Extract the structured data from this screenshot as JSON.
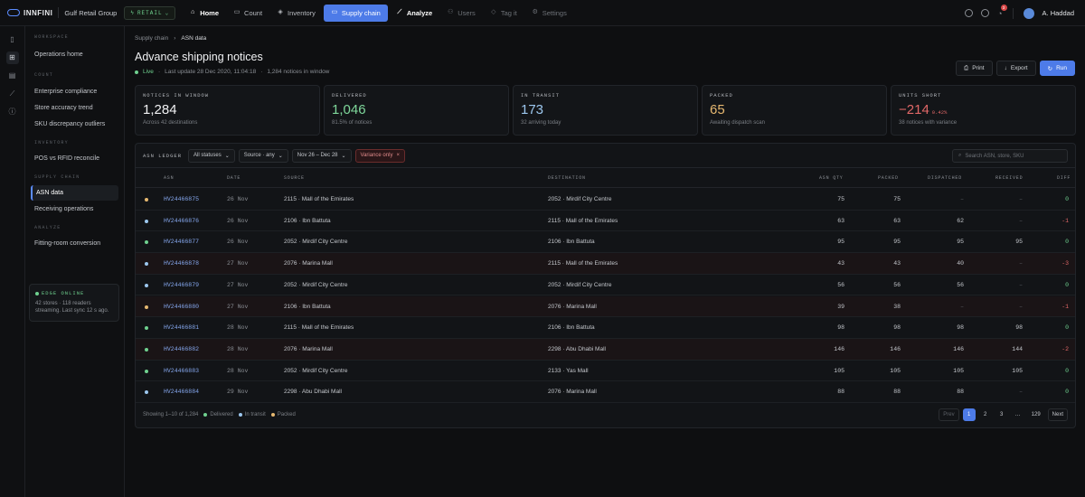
{
  "app": {
    "logo": "INNFINI",
    "org": "Gulf Retail Group",
    "mode": "RETAIL"
  },
  "nav": [
    {
      "label": "Home",
      "icon": "home-icon"
    },
    {
      "label": "Count",
      "icon": "count-icon"
    },
    {
      "label": "Inventory",
      "icon": "box-icon"
    },
    {
      "label": "Supply chain",
      "icon": "truck-icon"
    },
    {
      "label": "Analyze",
      "icon": "chart-icon"
    },
    {
      "label": "Users",
      "icon": "users-icon"
    },
    {
      "label": "Tag it",
      "icon": "tag-icon"
    },
    {
      "label": "Settings",
      "icon": "gear-icon"
    }
  ],
  "user": {
    "name": "A. Haddad",
    "notifications": "3"
  },
  "sidebar": {
    "workspace_label": "WORKSPACE",
    "home": "Operations home",
    "count_label": "COUNT",
    "count_items": [
      "Enterprise compliance",
      "Store accuracy trend",
      "SKU discrepancy outliers"
    ],
    "inventory_label": "INVENTORY",
    "inventory_items": [
      "POS vs RFID reconcile"
    ],
    "supply_label": "SUPPLY CHAIN",
    "supply_items": [
      "ASN data",
      "Receiving operations"
    ],
    "analyze_label": "ANALYZE",
    "analyze_items": [
      "Fitting-room conversion"
    ],
    "edge": {
      "title": "EDGE ONLINE",
      "text": "42 stores · 118 readers streaming. Last sync 12 s ago."
    }
  },
  "page": {
    "crumb_parent": "Supply chain",
    "crumb_current": "ASN data",
    "title": "Advance shipping notices",
    "live": "Live",
    "updated": "Last update 28 Dec 2020, 11:04:18",
    "window": "1,284 notices in window",
    "actions": {
      "print": "Print",
      "export": "Export",
      "run": "Run"
    }
  },
  "kpis": [
    {
      "label": "NOTICES IN WINDOW",
      "value": "1,284",
      "suffix": "",
      "sub": "Across 42 destinations",
      "color": "#f0f1f3"
    },
    {
      "label": "DELIVERED",
      "value": "1,046",
      "suffix": "",
      "sub": "81.5% of notices",
      "color": "#7fd89b"
    },
    {
      "label": "IN TRANSIT",
      "value": "173",
      "suffix": "",
      "sub": "32 arriving today",
      "color": "#9cc7ee"
    },
    {
      "label": "PACKED",
      "value": "65",
      "suffix": "",
      "sub": "Awaiting dispatch scan",
      "color": "#e6b870"
    },
    {
      "label": "UNITS SHORT",
      "value": "−214",
      "suffix": "0.42%",
      "sub": "38 notices with variance",
      "color": "#e06767"
    }
  ],
  "toolbar": {
    "label": "ASN LEDGER",
    "status": "All statuses",
    "source": "Source · any",
    "dates": "Nov 26 – Dec 28",
    "variance": "Variance only",
    "search_placeholder": "Search ASN, store, SKU"
  },
  "columns": [
    "ASN",
    "DATE",
    "SOURCE",
    "DESTINATION",
    "ASN QTY",
    "PACKED",
    "DISPATCHED",
    "RECEIVED",
    "DIFF"
  ],
  "rows": [
    {
      "asn": "HV24466875",
      "date": "26 Nov",
      "source": "2115 · Mall of the Emirates",
      "dest": "2052 · Mirdif City Centre",
      "qty": "75",
      "packed": "75",
      "dispatched": "–",
      "received": "–",
      "diff": "0",
      "status": "packed",
      "variance": false
    },
    {
      "asn": "HV24466876",
      "date": "26 Nov",
      "source": "2106 · Ibn Battuta",
      "dest": "2115 · Mall of the Emirates",
      "qty": "63",
      "packed": "63",
      "dispatched": "62",
      "received": "–",
      "diff": "-1",
      "status": "transit",
      "variance": false
    },
    {
      "asn": "HV24466877",
      "date": "26 Nov",
      "source": "2052 · Mirdif City Centre",
      "dest": "2106 · Ibn Battuta",
      "qty": "95",
      "packed": "95",
      "dispatched": "95",
      "received": "95",
      "diff": "0",
      "status": "delivered",
      "variance": false
    },
    {
      "asn": "HV24466878",
      "date": "27 Nov",
      "source": "2076 · Marina Mall",
      "dest": "2115 · Mall of the Emirates",
      "qty": "43",
      "packed": "43",
      "dispatched": "40",
      "received": "–",
      "diff": "-3",
      "status": "transit",
      "variance": true
    },
    {
      "asn": "HV24466879",
      "date": "27 Nov",
      "source": "2052 · Mirdif City Centre",
      "dest": "2052 · Mirdif City Centre",
      "qty": "56",
      "packed": "56",
      "dispatched": "56",
      "received": "–",
      "diff": "0",
      "status": "transit",
      "variance": false
    },
    {
      "asn": "HV24466880",
      "date": "27 Nov",
      "source": "2106 · Ibn Battuta",
      "dest": "2076 · Marina Mall",
      "qty": "39",
      "packed": "38",
      "dispatched": "–",
      "received": "–",
      "diff": "-1",
      "status": "packed",
      "variance": true
    },
    {
      "asn": "HV24466881",
      "date": "28 Nov",
      "source": "2115 · Mall of the Emirates",
      "dest": "2106 · Ibn Battuta",
      "qty": "98",
      "packed": "98",
      "dispatched": "98",
      "received": "98",
      "diff": "0",
      "status": "delivered",
      "variance": false
    },
    {
      "asn": "HV24466882",
      "date": "28 Nov",
      "source": "2076 · Marina Mall",
      "dest": "2298 · Abu Dhabi Mall",
      "qty": "146",
      "packed": "146",
      "dispatched": "146",
      "received": "144",
      "diff": "-2",
      "status": "delivered",
      "variance": true
    },
    {
      "asn": "HV24466883",
      "date": "28 Nov",
      "source": "2052 · Mirdif City Centre",
      "dest": "2133 · Yas Mall",
      "qty": "105",
      "packed": "105",
      "dispatched": "105",
      "received": "105",
      "diff": "0",
      "status": "delivered",
      "variance": false
    },
    {
      "asn": "HV24466884",
      "date": "29 Nov",
      "source": "2298 · Abu Dhabi Mall",
      "dest": "2076 · Marina Mall",
      "qty": "88",
      "packed": "88",
      "dispatched": "88",
      "received": "–",
      "diff": "0",
      "status": "transit",
      "variance": false
    }
  ],
  "status_colors": {
    "delivered": "#6fd18f",
    "transit": "#9cc7ee",
    "packed": "#e6b870"
  },
  "footer": {
    "showing": "Showing 1–10 of 1,284",
    "legend": [
      "Delivered",
      "In transit",
      "Packed"
    ],
    "pager": [
      "Prev",
      "1",
      "2",
      "3",
      "…",
      "129",
      "Next"
    ]
  }
}
